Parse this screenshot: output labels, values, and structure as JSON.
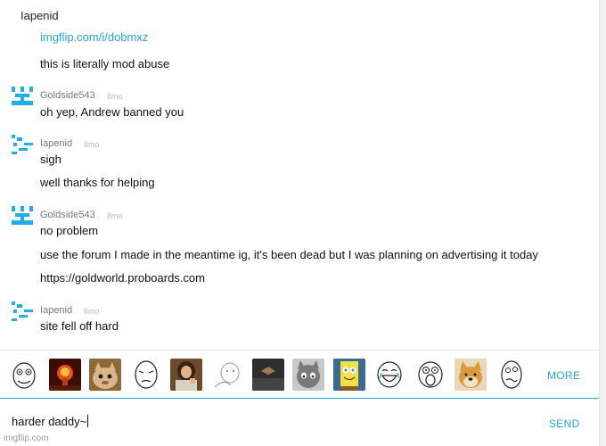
{
  "header": {
    "title": "Iapenid"
  },
  "chat": {
    "partial_link": "imgflip.com/i/dobmxz",
    "first_text": "this is literally mod abuse",
    "messages": [
      {
        "user": "Goldside543",
        "time": "8mo",
        "lines": [
          "oh yep, Andrew banned you"
        ]
      },
      {
        "user": "Iapenid",
        "time": "8mo",
        "lines": [
          "sigh",
          "well thanks for helping"
        ]
      },
      {
        "user": "Goldside543",
        "time": "8mo",
        "lines": [
          "no problem",
          "use the forum I made in the meantime ig, it's been dead but I was planning on advertising it today",
          "https://goldworld.proboards.com"
        ]
      },
      {
        "user": "Iapenid",
        "time": "6mo",
        "lines": [
          "site fell off hard"
        ]
      }
    ]
  },
  "meme_bar": {
    "memes": [
      "rage-face",
      "explosion",
      "cat",
      "okay-guy",
      "jesus",
      "sketch-guy",
      "dark-square",
      "sad-cat",
      "spongebob",
      "laughing-face",
      "omg-face",
      "doge",
      "derp-face"
    ],
    "more_label": "MORE"
  },
  "input": {
    "value": "harder daddy~",
    "send_label": "SEND"
  },
  "colors": {
    "accent": "#27a4d9",
    "gold_avatar": "#1faee6"
  },
  "watermark": "imgflip.com"
}
